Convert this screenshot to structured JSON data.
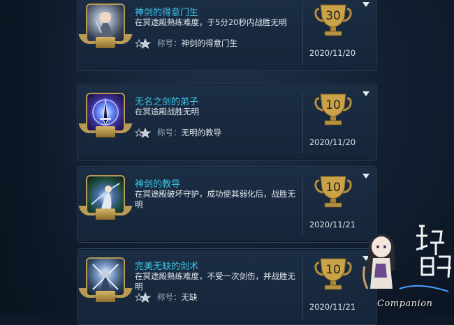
{
  "achievements": [
    {
      "title": "神剑的得意门生",
      "description": "在冥途殿熟练难度，于5分20秒内战胜无明",
      "reward_label": "称号：",
      "reward_value": "神剑的得意门生",
      "trophy_value": "30",
      "date": "2020/11/20",
      "emblem_icon": "swordswoman-portrait-emblem"
    },
    {
      "title": "无名之剑的弟子",
      "description": "在冥途殿战胜无明",
      "reward_label": "称号：",
      "reward_value": "无明的教导",
      "trophy_value": "10",
      "date": "2020/11/20",
      "emblem_icon": "glowing-sword-emblem"
    },
    {
      "title": "神剑的教导",
      "description": "在冥途殿破坏守护，成功使其弱化后，战胜无明",
      "reward_label": "",
      "reward_value": "",
      "trophy_value": "10",
      "date": "2020/11/21",
      "emblem_icon": "warrior-battle-emblem"
    },
    {
      "title": "完美无缺的剑术",
      "description": "在冥途殿熟练难度，不受一次剑伤，并战胜无明",
      "reward_label": "称号：",
      "reward_value": "无缺",
      "trophy_value": "10",
      "date": "2020/11/21",
      "emblem_icon": "crossed-swords-emblem"
    }
  ],
  "watermark": {
    "text": "Companion",
    "logo_icon": "chibi-character-logo"
  },
  "colors": {
    "title": "#3fc7ea",
    "trophy_gold": "#c9a24a",
    "card_border": "#2f4660"
  }
}
